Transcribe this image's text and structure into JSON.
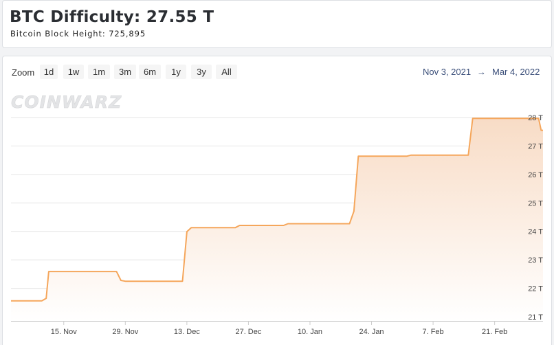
{
  "header": {
    "title": "BTC Difficulty: 27.55 T",
    "subtitle": "Bitcoin Block Height: 725,895"
  },
  "toolbar": {
    "zoom_label": "Zoom",
    "buttons": [
      "1d",
      "1w",
      "1m",
      "3m",
      "6m",
      "1y",
      "3y",
      "All"
    ],
    "range_from": "Nov 3, 2021",
    "range_arrow": "→",
    "range_to": "Mar 4, 2022"
  },
  "watermark": "COINWARZ",
  "colors": {
    "line": "#f5a65b",
    "area_top": "#f8dcc6",
    "area_bottom": "#ffffff",
    "grid": "#e6e6e6"
  },
  "chart_data": {
    "type": "area",
    "ylabel_unit": "T",
    "ylim": [
      21,
      28
    ],
    "y_ticks": [
      "21 T",
      "22 T",
      "23 T",
      "24 T",
      "25 T",
      "26 T",
      "27 T",
      "28 T"
    ],
    "xlim": [
      "2021-11-03",
      "2022-03-04"
    ],
    "x_ticks": [
      {
        "date": "2021-11-15",
        "label": "15. Nov"
      },
      {
        "date": "2021-11-29",
        "label": "29. Nov"
      },
      {
        "date": "2021-12-13",
        "label": "13. Dec"
      },
      {
        "date": "2021-12-27",
        "label": "27. Dec"
      },
      {
        "date": "2022-01-10",
        "label": "10. Jan"
      },
      {
        "date": "2022-01-24",
        "label": "24. Jan"
      },
      {
        "date": "2022-02-07",
        "label": "7. Feb"
      },
      {
        "date": "2022-02-21",
        "label": "21. Feb"
      }
    ],
    "grid": true,
    "series": [
      {
        "points": [
          [
            "2021-11-03",
            21.56
          ],
          [
            "2021-11-10",
            21.56
          ],
          [
            "2021-11-11",
            21.65
          ],
          [
            "2021-11-11T14:00",
            22.59
          ],
          [
            "2021-11-27",
            22.59
          ],
          [
            "2021-11-28",
            22.28
          ],
          [
            "2021-11-29",
            22.25
          ],
          [
            "2021-12-12",
            22.25
          ],
          [
            "2021-12-13",
            23.99
          ],
          [
            "2021-12-14",
            24.13
          ],
          [
            "2021-12-24",
            24.13
          ],
          [
            "2021-12-25",
            24.21
          ],
          [
            "2022-01-04",
            24.21
          ],
          [
            "2022-01-05",
            24.27
          ],
          [
            "2022-01-19",
            24.27
          ],
          [
            "2022-01-20",
            24.71
          ],
          [
            "2022-01-21",
            26.64
          ],
          [
            "2022-02-01",
            26.64
          ],
          [
            "2022-02-02",
            26.68
          ],
          [
            "2022-02-15",
            26.68
          ],
          [
            "2022-02-16",
            27.97
          ],
          [
            "2022-03-03",
            27.97
          ],
          [
            "2022-03-03T14:00",
            27.55
          ],
          [
            "2022-03-04",
            27.55
          ]
        ]
      }
    ]
  }
}
